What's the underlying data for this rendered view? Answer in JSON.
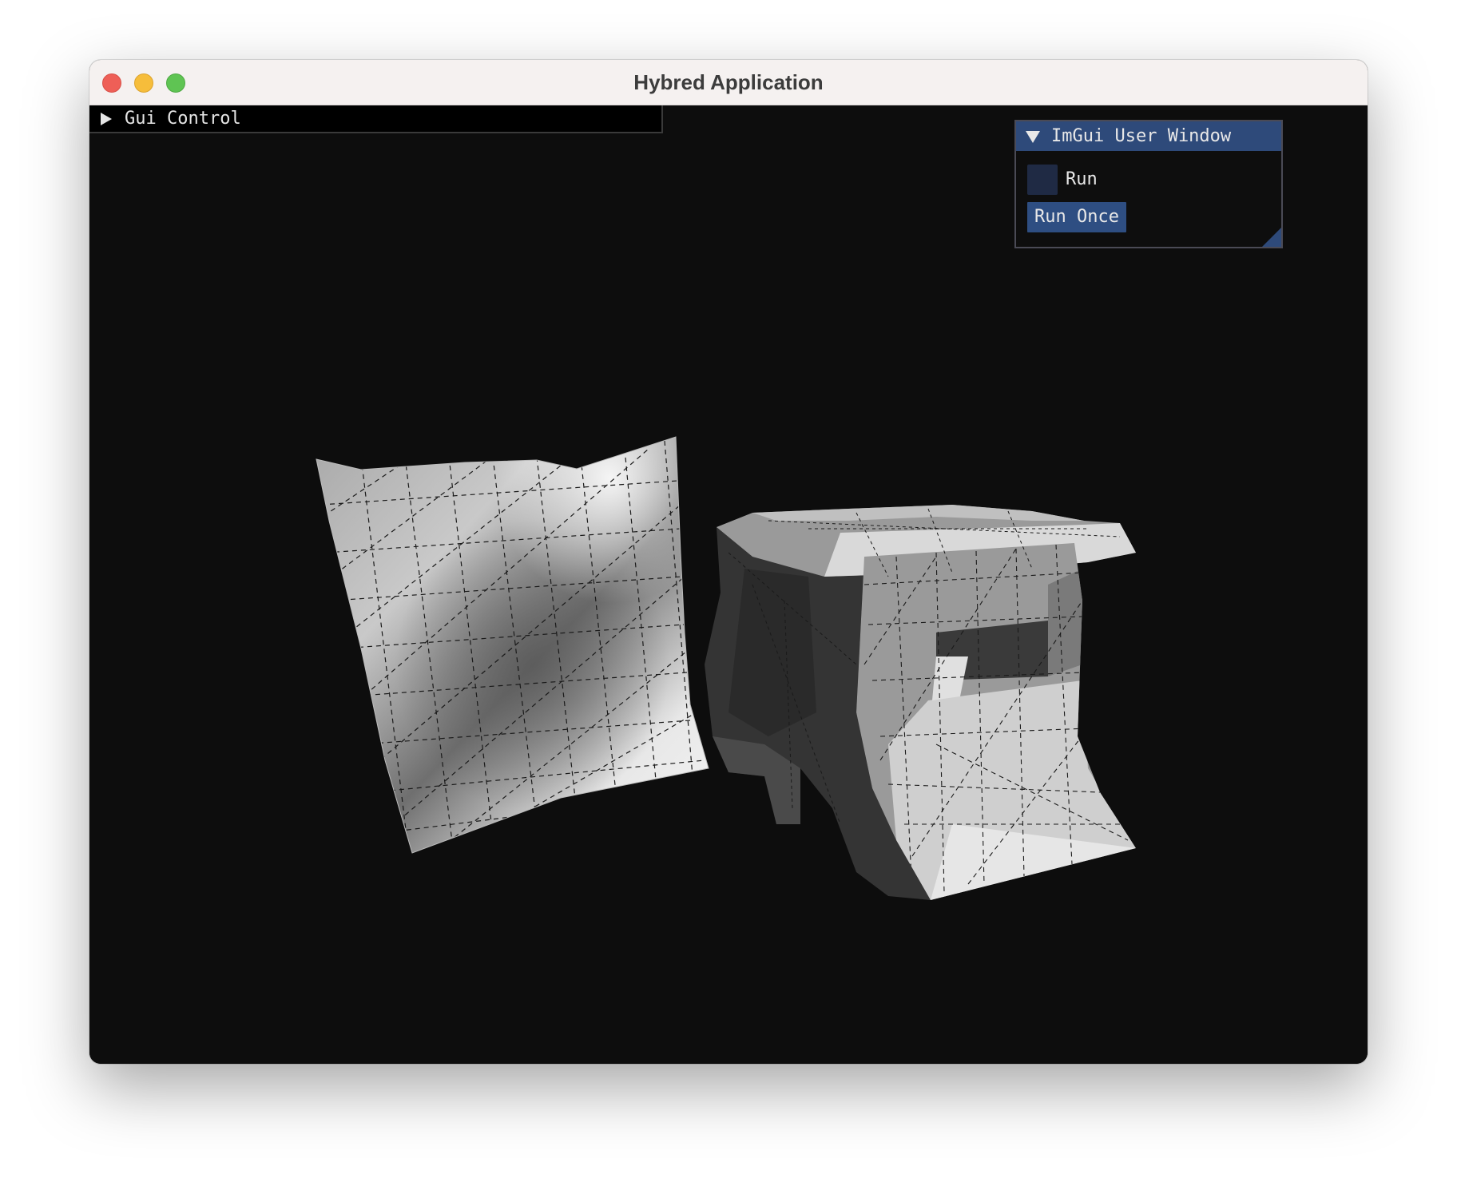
{
  "window": {
    "title": "Hybred Application",
    "controls": [
      "close",
      "minimize",
      "maximize"
    ]
  },
  "gui_control": {
    "label": "Gui Control",
    "expanded": false
  },
  "imgui_window": {
    "title": "ImGui User Window",
    "expanded": true,
    "run_checkbox": {
      "label": "Run",
      "checked": false
    },
    "run_once_button": {
      "label": "Run Once"
    }
  },
  "scene": {
    "background": "#0d0d0d",
    "objects": [
      "cloth-mesh",
      "deformed-box-mesh"
    ]
  },
  "colors": {
    "close": "#ee5f57",
    "minimize": "#f6bd3b",
    "maximize": "#5fc453",
    "imgui_accent": "#2e4a7a"
  }
}
